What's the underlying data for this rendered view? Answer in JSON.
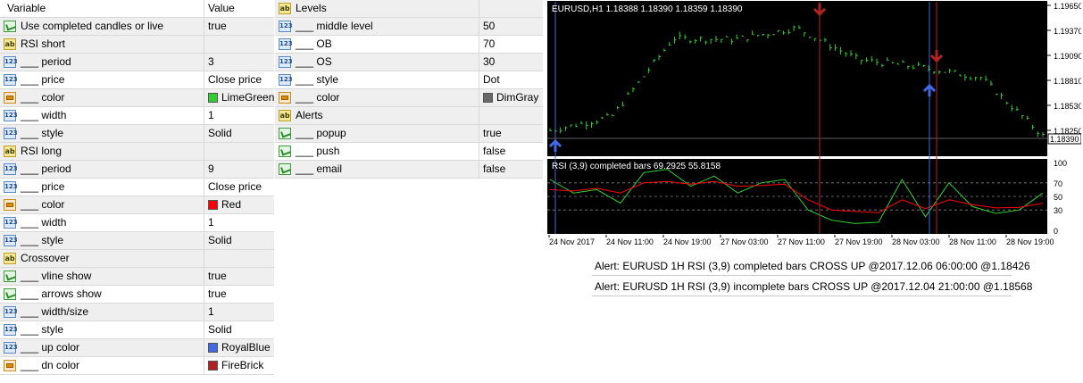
{
  "left_grid": {
    "header": {
      "variable": "Variable",
      "value": "Value"
    },
    "rows": [
      {
        "icon": "bool",
        "label": "Use completed candles or live",
        "value": "true"
      },
      {
        "icon": "ab",
        "label": "RSI short",
        "value": ""
      },
      {
        "icon": "123",
        "label": "___ period",
        "value": "3"
      },
      {
        "icon": "123",
        "label": "___ price",
        "value": "Close price"
      },
      {
        "icon": "color",
        "label": "___ color",
        "value": "LimeGreen",
        "swatch": "#32cd32"
      },
      {
        "icon": "123",
        "label": "___ width",
        "value": "1"
      },
      {
        "icon": "123",
        "label": "___ style",
        "value": "Solid"
      },
      {
        "icon": "ab",
        "label": "RSI long",
        "value": ""
      },
      {
        "icon": "123",
        "label": "___ period",
        "value": "9"
      },
      {
        "icon": "123",
        "label": "___ price",
        "value": "Close price"
      },
      {
        "icon": "color",
        "label": "___ color",
        "value": "Red",
        "swatch": "#ff0000"
      },
      {
        "icon": "123",
        "label": "___ width",
        "value": "1"
      },
      {
        "icon": "123",
        "label": "___ style",
        "value": "Solid"
      },
      {
        "icon": "ab",
        "label": "Crossover",
        "value": ""
      },
      {
        "icon": "bool",
        "label": "___ vline show",
        "value": "true"
      },
      {
        "icon": "bool",
        "label": "___ arrows show",
        "value": "true"
      },
      {
        "icon": "123",
        "label": "___ width/size",
        "value": "1"
      },
      {
        "icon": "123",
        "label": "___ style",
        "value": "Solid"
      },
      {
        "icon": "123",
        "label": "___ up color",
        "value": "RoyalBlue",
        "swatch": "#4169e1"
      },
      {
        "icon": "color",
        "label": "___ dn color",
        "value": "FireBrick",
        "swatch": "#b22222"
      }
    ]
  },
  "right_grid": {
    "rows": [
      {
        "icon": "ab",
        "label": "Levels",
        "value": ""
      },
      {
        "icon": "123",
        "label": "___ middle level",
        "value": "50"
      },
      {
        "icon": "123",
        "label": "___ OB",
        "value": "70"
      },
      {
        "icon": "123",
        "label": "___ OS",
        "value": "30"
      },
      {
        "icon": "123",
        "label": "___ style",
        "value": "Dot"
      },
      {
        "icon": "color",
        "label": "___ color",
        "value": "DimGray",
        "swatch": "#696969"
      },
      {
        "icon": "ab",
        "label": "Alerts",
        "value": ""
      },
      {
        "icon": "bool",
        "label": "___ popup",
        "value": "true"
      },
      {
        "icon": "bool",
        "label": "___ push",
        "value": "false"
      },
      {
        "icon": "bool",
        "label": "___ email",
        "value": "false"
      }
    ]
  },
  "chart": {
    "symbol_label": "EURUSD,H1  1.18388 1.18390 1.18359 1.18390",
    "price_ticks": [
      "1.19650",
      "1.19370",
      "1.19090",
      "1.18810",
      "1.18530",
      "1.18250"
    ],
    "current_price": "1.18390",
    "rsi_label": "RSI (3,9)  completed bars 69.2925 55.8158",
    "rsi_ticks": [
      "100",
      "70",
      "50",
      "30",
      "0"
    ],
    "time_ticks": [
      "24 Nov 2017",
      "24 Nov 11:00",
      "24 Nov 19:00",
      "27 Nov 03:00",
      "27 Nov 11:00",
      "27 Nov 19:00",
      "28 Nov 03:00",
      "28 Nov 11:00",
      "28 Nov 19:00"
    ],
    "colors": {
      "background": "#000000",
      "candles": "#32cd32",
      "rsi_short": "#32cd32",
      "rsi_long": "#ff0000",
      "up_arrow": "#4169e1",
      "dn_arrow": "#b22222",
      "grid": "#c0c0c0"
    }
  },
  "chart_data": {
    "type": "line",
    "title": "EURUSD,H1  1.18388 1.18390 1.18359 1.18390",
    "xlabel": "",
    "ylabel": "",
    "ylim": [
      1.1825,
      1.1965
    ],
    "x": [
      "24 Nov 2017",
      "24 Nov 11:00",
      "24 Nov 19:00",
      "27 Nov 03:00",
      "27 Nov 11:00",
      "27 Nov 19:00",
      "28 Nov 03:00",
      "28 Nov 11:00",
      "28 Nov 19:00"
    ],
    "series": [
      {
        "values": [
          1.1845,
          1.1858,
          1.1932,
          1.1931,
          1.1942,
          1.1912,
          1.1905,
          1.1895,
          1.184
        ]
      }
    ],
    "rsi_panel": {
      "title": "RSI (3,9)  completed bars 69.2925 55.8158",
      "ylim": [
        0,
        100
      ],
      "levels": [
        70,
        50,
        30
      ],
      "series": [
        {
          "values": [
            75,
            55,
            60,
            40,
            85,
            90,
            65,
            80,
            55,
            70,
            75,
            30,
            15,
            10,
            12,
            75,
            20,
            70,
            35,
            25,
            30,
            55
          ]
        },
        {
          "values": [
            60,
            58,
            62,
            55,
            70,
            72,
            68,
            72,
            65,
            66,
            68,
            45,
            30,
            28,
            26,
            45,
            32,
            45,
            38,
            33,
            34,
            40
          ]
        }
      ]
    }
  },
  "alerts": [
    "Alert: EURUSD 1H RSI (3,9)  completed bars CROSS UP @2017.12.06 06:00:00 @1.18426",
    "Alert: EURUSD 1H RSI (3,9)  incomplete bars CROSS UP @2017.12.04 21:00:00 @1.18568"
  ]
}
